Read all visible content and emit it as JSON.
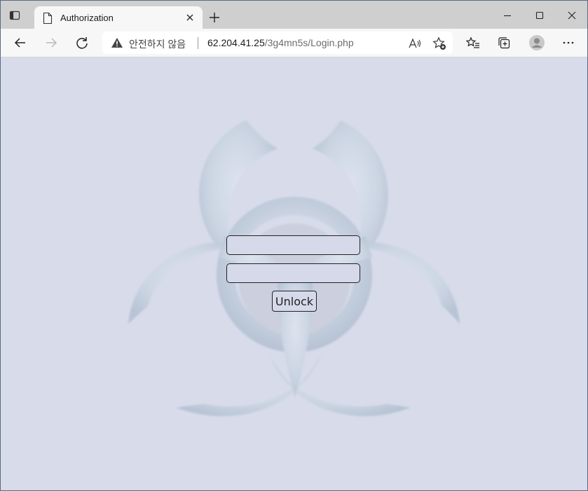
{
  "browser": {
    "tab": {
      "title": "Authorization",
      "favicon": "page-icon"
    },
    "new_tab_label": "+",
    "address": {
      "security_label": "안전하지 않음",
      "host": "62.204.41.25",
      "path": "/3g4mn5s/Login.php"
    },
    "icons": {
      "back": "back-arrow-icon",
      "forward": "forward-arrow-icon",
      "refresh": "refresh-icon",
      "read_aloud": "read-aloud-icon",
      "add_favorite": "add-favorite-icon",
      "favorites": "favorites-icon",
      "collections": "collections-icon",
      "profile": "profile-icon",
      "menu": "more-menu-icon"
    }
  },
  "page": {
    "background_symbol": "biohazard-symbol",
    "username": {
      "value": "",
      "placeholder": ""
    },
    "password": {
      "value": "",
      "placeholder": ""
    },
    "unlock_label": "Unlock"
  },
  "colors": {
    "page_background": "#d7dbea",
    "tabstrip": "#cfcfcf",
    "toolbar": "#f7f7f7",
    "symbol": "#b7c6d6"
  }
}
